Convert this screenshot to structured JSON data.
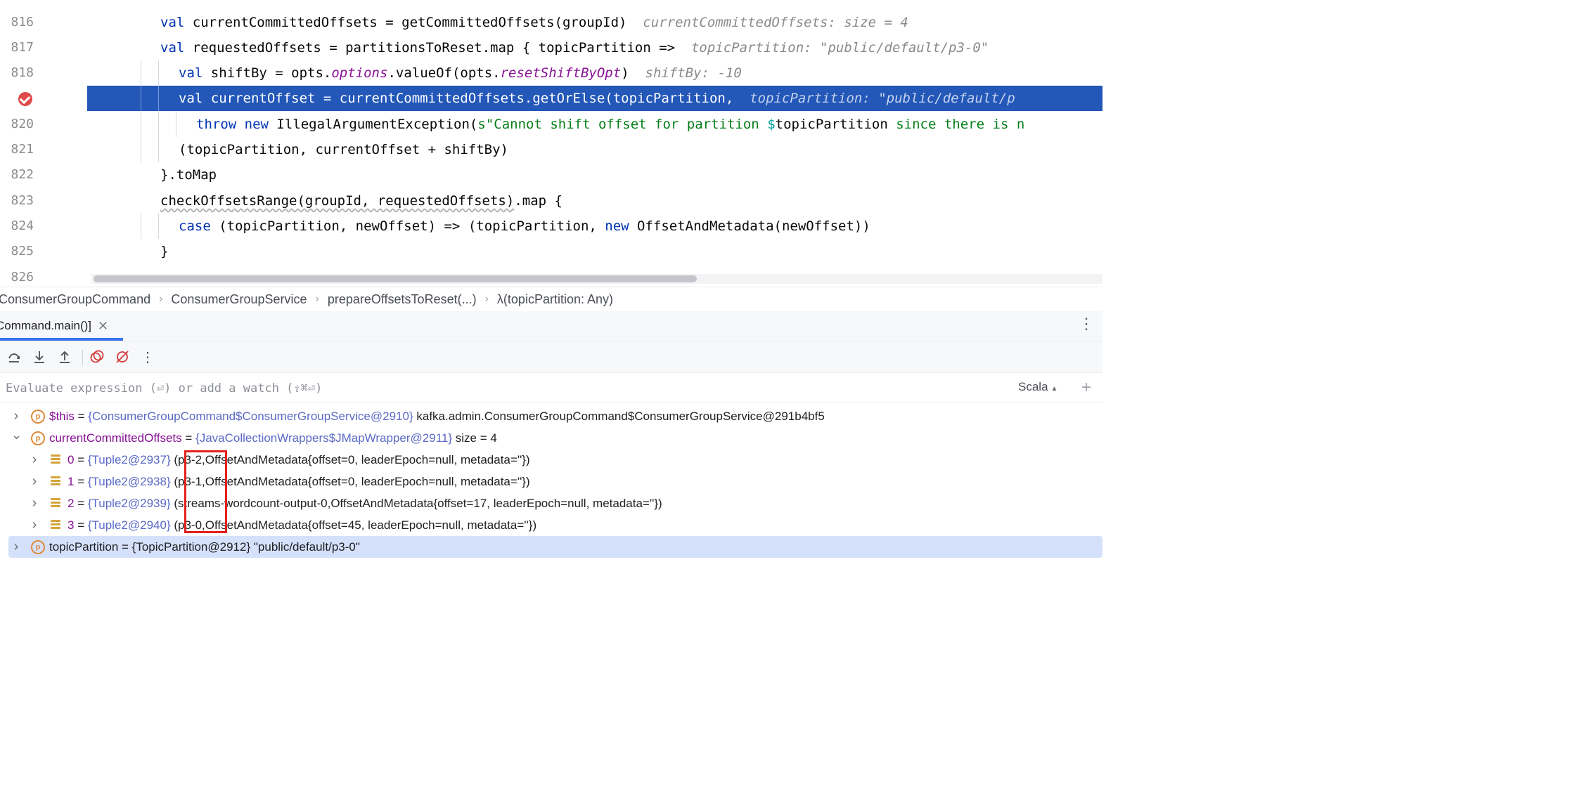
{
  "editor": {
    "lines": [
      {
        "num": "816",
        "tokens": [
          {
            "t": "kw",
            "v": "val"
          },
          {
            "t": "",
            "v": " currentCommittedOffsets = getCommittedOffsets(groupId)  "
          },
          {
            "t": "hint",
            "v": "currentCommittedOffsets: size = 4"
          }
        ]
      },
      {
        "num": "817",
        "tokens": [
          {
            "t": "kw",
            "v": "val"
          },
          {
            "t": "",
            "v": " requestedOffsets = partitionsToReset.map { topicPartition =>  "
          },
          {
            "t": "hint",
            "v": "topicPartition: \"public/default/p3-0\""
          }
        ]
      },
      {
        "num": "818",
        "tokens": [
          {
            "t": "kw",
            "v": "val"
          },
          {
            "t": "",
            "v": " shiftBy = opts."
          },
          {
            "t": "fld",
            "v": "options"
          },
          {
            "t": "",
            "v": ".valueOf(opts."
          },
          {
            "t": "fld",
            "v": "resetShiftByOpt"
          },
          {
            "t": "",
            "v": ")  "
          },
          {
            "t": "hint",
            "v": "shiftBy: -10"
          }
        ]
      },
      {
        "num": "",
        "tokens": [
          {
            "t": "kw",
            "v": "val"
          },
          {
            "t": "",
            "v": " currentOffset = currentCommittedOffsets.getOrElse(topicPartition,  "
          },
          {
            "t": "hint",
            "v": "topicPartition: \"public/default/p"
          }
        ]
      },
      {
        "num": "820",
        "tokens": [
          {
            "t": "kw",
            "v": "throw new"
          },
          {
            "t": "",
            "v": " IllegalArgumentException("
          },
          {
            "t": "str",
            "v": "s\"Cannot shift offset for partition "
          },
          {
            "t": "dollar",
            "v": "$"
          },
          {
            "t": "",
            "v": "topicPartition"
          },
          {
            "t": "str",
            "v": " since there is n"
          }
        ]
      },
      {
        "num": "821",
        "tokens": [
          {
            "t": "",
            "v": "(topicPartition, currentOffset + shiftBy)"
          }
        ]
      },
      {
        "num": "822",
        "tokens": [
          {
            "t": "",
            "v": "}.toMap"
          }
        ]
      },
      {
        "num": "823",
        "tokens": [
          {
            "t": "sq",
            "v": "checkOffsetsRange(groupId, requestedOffsets)"
          },
          {
            "t": "",
            "v": ".map {"
          }
        ]
      },
      {
        "num": "824",
        "tokens": [
          {
            "t": "kw",
            "v": "case"
          },
          {
            "t": "",
            "v": " (topicPartition, newOffset) => (topicPartition, "
          },
          {
            "t": "kw",
            "v": "new"
          },
          {
            "t": "",
            "v": " OffsetAndMetadata(newOffset))"
          }
        ]
      },
      {
        "num": "825",
        "tokens": [
          {
            "t": "",
            "v": "}"
          }
        ]
      },
      {
        "num": "826",
        "tokens": [
          {
            "t": "",
            "v": ""
          }
        ]
      }
    ]
  },
  "breadcrumb": [
    "ConsumerGroupCommand",
    "ConsumerGroupService",
    "prepareOffsetsToReset(...)",
    "λ(topicPartition: Any)"
  ],
  "debug": {
    "tab_label": "Command.main()]",
    "evaluate_placeholder": "Evaluate expression (⏎) or add a watch (⇧⌘⏎)",
    "language": "Scala"
  },
  "variables": [
    {
      "indent": 0,
      "expanded": false,
      "kind": "p",
      "name": "$this",
      "type": "{ConsumerGroupCommand$ConsumerGroupService@2910}",
      "value": "kafka.admin.ConsumerGroupCommand$ConsumerGroupService@291b4bf5",
      "selected": false
    },
    {
      "indent": 0,
      "expanded": true,
      "kind": "p",
      "name": "currentCommittedOffsets",
      "type": "{JavaCollectionWrappers$JMapWrapper@2911}",
      "value": "size = 4",
      "selected": false
    },
    {
      "indent": 1,
      "expanded": false,
      "kind": "list",
      "name": "0",
      "type": "{Tuple2@2937}",
      "value": "(p3-2,OffsetAndMetadata{offset=0, leaderEpoch=null, metadata=''})",
      "selected": false
    },
    {
      "indent": 1,
      "expanded": false,
      "kind": "list",
      "name": "1",
      "type": "{Tuple2@2938}",
      "value": "(p3-1,OffsetAndMetadata{offset=0, leaderEpoch=null, metadata=''})",
      "selected": false
    },
    {
      "indent": 1,
      "expanded": false,
      "kind": "list",
      "name": "2",
      "type": "{Tuple2@2939}",
      "value": "(streams-wordcount-output-0,OffsetAndMetadata{offset=17, leaderEpoch=null, metadata=''})",
      "selected": false
    },
    {
      "indent": 1,
      "expanded": false,
      "kind": "list",
      "name": "3",
      "type": "{Tuple2@2940}",
      "value": "(p3-0,OffsetAndMetadata{offset=45, leaderEpoch=null, metadata=''})",
      "selected": false
    },
    {
      "indent": 0,
      "expanded": false,
      "kind": "p",
      "name": "topicPartition",
      "type": "{TopicPartition@2912}",
      "value": "\"public/default/p3-0\"",
      "selected": true
    }
  ]
}
